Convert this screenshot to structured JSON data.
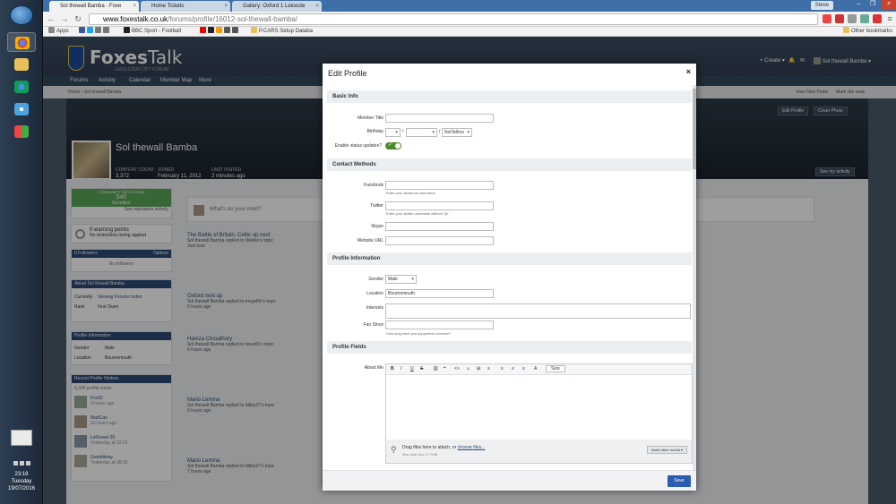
{
  "taskbar": {
    "time": "23:18",
    "day": "Tuesday",
    "date": "19/07/2016"
  },
  "browser": {
    "tabs": [
      {
        "label": "Sol thewall Bamba - Foxe"
      },
      {
        "label": "Home Tickets"
      },
      {
        "label": "Gallery: Oxford 1 Leiceste"
      }
    ],
    "user": "Steve",
    "url_host": "www.foxestalk.co.uk",
    "url_path": "/forums/profile/16012-sol-thewall-bamba/",
    "bookmarks": [
      "Apps",
      "BBC Sport - Football",
      "P.CARS Setup Databa"
    ],
    "other_bookmarks": "Other bookmarks"
  },
  "site": {
    "logo_bold": "Foxes",
    "logo_light": "Talk",
    "tagline": "LEICESTER CITY FORUM",
    "create": "Create",
    "user": "Sol thewall Bamba",
    "nav": [
      "Forums",
      "Activity",
      "Calendar",
      "Member Map",
      "More"
    ],
    "breadcrumb": "Home › Sol thewall Bamba",
    "crumb_right": [
      "View New Posts",
      "Mark site read"
    ]
  },
  "profile": {
    "name": "Sol thewall Bamba",
    "stats": [
      {
        "label": "CONTENT COUNT",
        "value": "3,372"
      },
      {
        "label": "JOINED",
        "value": "February 11, 2012"
      },
      {
        "label": "LAST VISITED",
        "value": "2 minutes ago"
      }
    ],
    "edit_profile": "Edit Profile",
    "cover_photo": "Cover Photo",
    "see_activity": "See my activity",
    "reputation": {
      "label": "COMMUNITY REPUTATION",
      "value": "540",
      "rank": "Excellent",
      "link": "See reputation activity"
    },
    "warnings": "0 warning points",
    "warnings_sub": "No restrictions being applied",
    "followers": "0 Followers",
    "followers_opt": "Options",
    "no_followers": "No followers",
    "about_header": "About Sol thewall Bamba",
    "about": [
      {
        "k": "Currently",
        "v": "Viewing Forums Index"
      },
      {
        "k": "Rank",
        "v": "First Team"
      }
    ],
    "info_header": "Profile Information",
    "info": [
      {
        "k": "Gender",
        "v": "Male"
      },
      {
        "k": "Location",
        "v": "Bournemouth"
      }
    ],
    "visitors_header": "Recent Profile Visitors",
    "visitors_count": "5,340 profile views",
    "visitors": [
      {
        "n": "Fox62",
        "t": "3 hours ago"
      },
      {
        "n": "MattCan",
        "t": "10 hours ago"
      },
      {
        "n": "LeiFoxes 05",
        "t": "Yesterday at 19:21"
      },
      {
        "n": "Gambitway",
        "t": "Yesterday at 09:32"
      }
    ],
    "status_placeholder": "What's on your mind?",
    "feed": [
      {
        "title": "The Battle of Britain, Celtic up next",
        "sub": "Sol thewall Bamba replied to Welder's topic",
        "meta": "Just now"
      },
      {
        "title": "Oxford next up",
        "sub": "Sol thewall Bamba replied to mcgaffin's topic",
        "meta": "5 hours ago"
      },
      {
        "title": "Hamza Choudhury",
        "sub": "Sol thewall Bamba replied to dave81's topic",
        "meta": "6 hours ago"
      },
      {
        "title": "Mario Lemina",
        "sub": "Sol thewall Bamba replied to Miley27's topic",
        "meta": "6 hours ago"
      },
      {
        "title": "Mario Lemina",
        "sub": "Sol thewall Bamba replied to Miley27's topic",
        "meta": "7 hours ago"
      }
    ]
  },
  "modal": {
    "title": "Edit Profile",
    "close_icon": "×",
    "sections": {
      "basic": "Basic Info",
      "contact": "Contact Methods",
      "profile": "Profile Information",
      "fields": "Profile Fields"
    },
    "member_title": {
      "label": "Member Title",
      "value": ""
    },
    "birthday": {
      "label": "Birthday",
      "tell": "NotTellms"
    },
    "status_updates": {
      "label": "Enable status updates?",
      "on": true
    },
    "facebook": {
      "label": "Facebook",
      "value": "",
      "hint": "Enter your facebook username"
    },
    "twitter": {
      "label": "Twitter",
      "value": "",
      "hint": "Enter your twitter username without '@'"
    },
    "skype": {
      "label": "Skype",
      "value": ""
    },
    "website": {
      "label": "Website URL",
      "value": ""
    },
    "gender": {
      "label": "Gender",
      "value": "Male"
    },
    "location": {
      "label": "Location",
      "value": "Bournemouth"
    },
    "interests": {
      "label": "Interests",
      "value": ""
    },
    "fan_since": {
      "label": "Fan Since",
      "value": "",
      "hint": "How long have you supported Leicester?"
    },
    "about_me": {
      "label": "About Me"
    },
    "editor_tools": [
      "B",
      "I",
      "U",
      "S",
      "⛓",
      "❝",
      "<>",
      "☺",
      "⊞",
      "≡",
      "≡",
      "≡",
      "≡",
      "A",
      "Size"
    ],
    "attach_text": "Drag files here to attach, or",
    "attach_link": "choose files...",
    "attach_sub": "Max total size 0.77MB",
    "insert_media": "Insert other media",
    "save": "Save"
  }
}
